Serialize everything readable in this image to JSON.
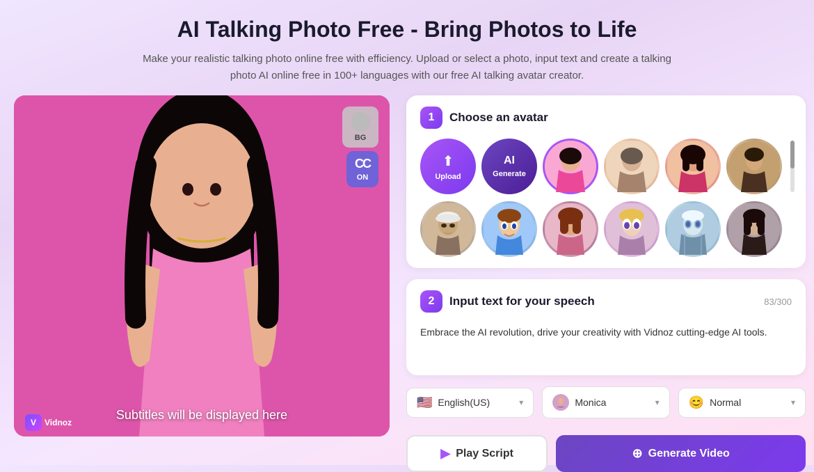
{
  "header": {
    "title": "AI Talking Photo Free - Bring Photos to Life",
    "subtitle": "Make your realistic talking photo online free with efficiency. Upload or select a photo, input text and create a talking photo AI online free in 100+ languages with our free AI talking avatar creator."
  },
  "sections": {
    "choose_avatar": {
      "number": "1",
      "title": "Choose an avatar",
      "upload_label": "Upload",
      "generate_label": "Generate",
      "avatars": [
        {
          "id": "einstein",
          "emoji": "👴"
        },
        {
          "id": "cartoon-boy",
          "emoji": "🧑"
        },
        {
          "id": "princess",
          "emoji": "👸"
        },
        {
          "id": "robot-woman",
          "emoji": "🤖"
        },
        {
          "id": "angel",
          "emoji": "👼"
        },
        {
          "id": "dark-figure",
          "emoji": "🧛"
        }
      ]
    },
    "input_text": {
      "number": "2",
      "title": "Input text for your speech",
      "char_count": "83/300",
      "speech_text": "Embrace the AI revolution, drive your creativity with Vidnoz cutting-edge AI tools."
    },
    "controls": {
      "language": "English(US)",
      "voice": "Monica",
      "mood": "Normal",
      "dropdown_arrow": "▾"
    },
    "buttons": {
      "play_script": "Play Script",
      "generate_video": "Generate Video"
    }
  },
  "photo_panel": {
    "bg_label": "BG",
    "cc_label": "ON",
    "subtitle_placeholder": "Subtitles will be displayed here",
    "brand_name": "Vidnoz"
  },
  "colors": {
    "accent": "#a855f7",
    "gradient_start": "#6b46c1",
    "gradient_end": "#7c3aed"
  }
}
